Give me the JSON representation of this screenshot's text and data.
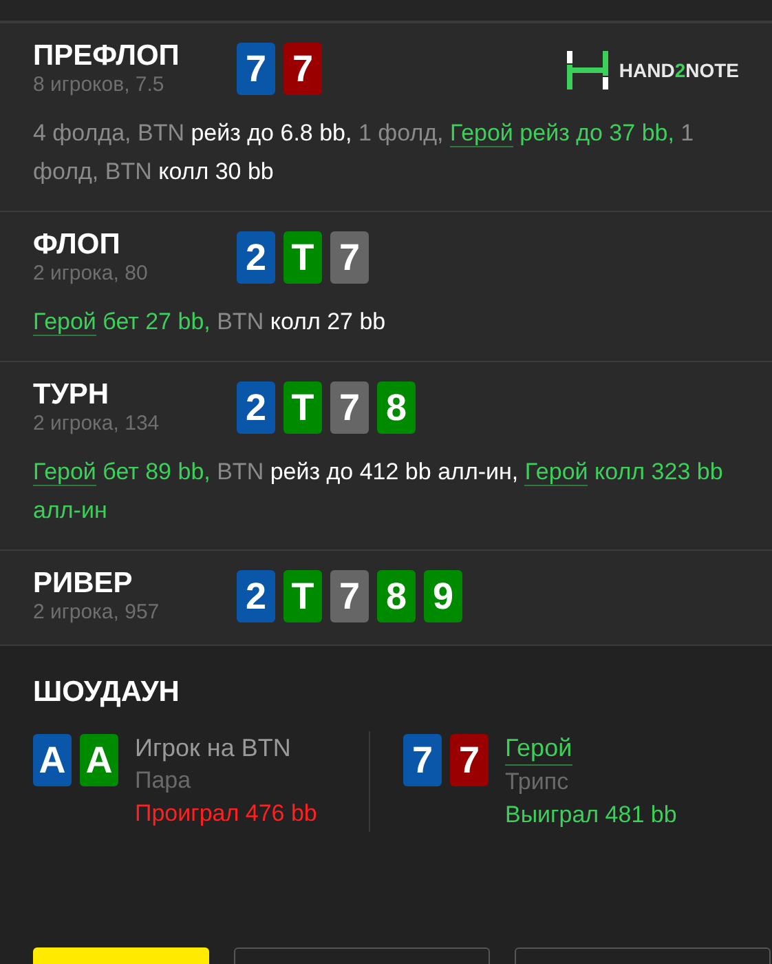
{
  "logo": {
    "text": "HAND**2**NOTE"
  },
  "streets": [
    {
      "title": "ПРЕФЛОП",
      "subtitle": "8 игроков, 7.5",
      "cards": [
        {
          "rank": "7",
          "color": "#0a56a8"
        },
        {
          "rank": "7",
          "color": "#9a0000"
        }
      ],
      "actions": [
        [
          {
            "text": "4 фолда, BTN ",
            "kind": "muted"
          },
          {
            "text": "рейз до 6.8 bb,",
            "kind": "plain"
          },
          {
            "text": " 1 фолд, ",
            "kind": "muted"
          },
          {
            "text": "Герой",
            "kind": "hero"
          },
          {
            "text": " рейз до 37 bb,",
            "kind": "green"
          },
          {
            "text": " 1 фолд, BTN ",
            "kind": "muted"
          },
          {
            "text": "колл 30 bb",
            "kind": "plain"
          }
        ]
      ]
    },
    {
      "title": "ФЛОП",
      "subtitle": "2 игрока, 80",
      "cards": [
        {
          "rank": "2",
          "color": "#0a56a8"
        },
        {
          "rank": "T",
          "color": "#008a00"
        },
        {
          "rank": "7",
          "color": "#666666"
        }
      ],
      "actions": [
        [
          {
            "text": "Герой",
            "kind": "hero"
          },
          {
            "text": " бет 27 bb,",
            "kind": "green"
          },
          {
            "text": " BTN ",
            "kind": "muted"
          },
          {
            "text": "колл 27 bb",
            "kind": "plain"
          }
        ]
      ]
    },
    {
      "title": "ТУРН",
      "subtitle": "2 игрока, 134",
      "cards": [
        {
          "rank": "2",
          "color": "#0a56a8"
        },
        {
          "rank": "T",
          "color": "#008a00"
        },
        {
          "rank": "7",
          "color": "#666666"
        },
        {
          "rank": "8",
          "color": "#008a00"
        }
      ],
      "actions": [
        [
          {
            "text": "Герой",
            "kind": "hero"
          },
          {
            "text": " бет 89 bb,",
            "kind": "green"
          },
          {
            "text": " BTN ",
            "kind": "muted"
          },
          {
            "text": "рейз до 412 bb алл-ин, ",
            "kind": "plain"
          },
          {
            "text": "Герой",
            "kind": "hero"
          },
          {
            "text": " колл 323 bb алл-ин",
            "kind": "green"
          }
        ]
      ]
    },
    {
      "title": "РИВЕР",
      "subtitle": "2 игрока, 957",
      "cards": [
        {
          "rank": "2",
          "color": "#0a56a8"
        },
        {
          "rank": "T",
          "color": "#008a00"
        },
        {
          "rank": "7",
          "color": "#666666"
        },
        {
          "rank": "8",
          "color": "#008a00"
        },
        {
          "rank": "9",
          "color": "#008a00"
        }
      ]
    }
  ],
  "showdown": {
    "title": "ШОУДАУН",
    "players": [
      {
        "name": "Игрок на BTN",
        "hero": false,
        "hand": "Пара",
        "result": "Проиграл 476 bb",
        "kind": "loss",
        "cards": [
          {
            "rank": "A",
            "color": "#0a56a8"
          },
          {
            "rank": "A",
            "color": "#008a00"
          }
        ]
      },
      {
        "name": "Герой",
        "hero": true,
        "hand": "Трипс",
        "result": "Выиграл 481 bb",
        "kind": "win",
        "cards": [
          {
            "rank": "7",
            "color": "#0a56a8"
          },
          {
            "rank": "7",
            "color": "#9a0000"
          }
        ]
      }
    ]
  },
  "buttons": [
    {
      "kind": "primary"
    },
    {
      "kind": "outline"
    },
    {
      "kind": "outline"
    }
  ]
}
